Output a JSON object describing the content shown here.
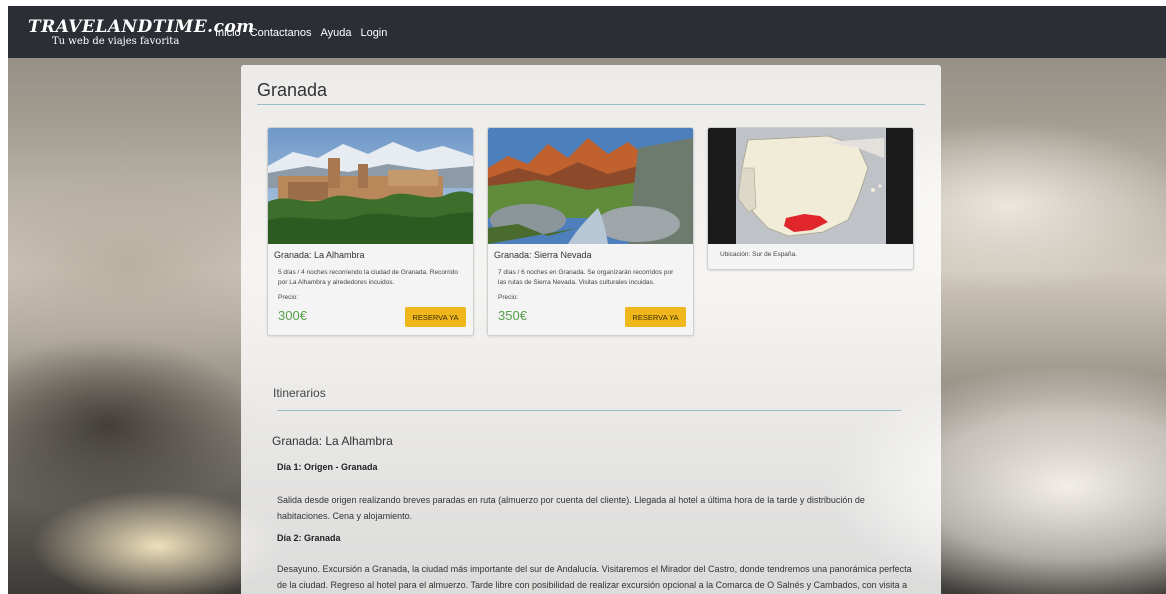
{
  "brand": {
    "logo": "TRAVELANDTIME.com",
    "tagline": "Tu web de viajes favorita"
  },
  "nav": {
    "items": [
      "Inicio",
      "Contactanos",
      "Ayuda",
      "Login"
    ]
  },
  "page": {
    "title": "Granada",
    "cards": [
      {
        "title": "Granada: La Alhambra",
        "description": "5 días / 4 noches recorriendo la ciudad de Granada. Recorrido por La Alhambra y alrededores incuidos.",
        "price_label": "Precio:",
        "price": "300€",
        "button": "RESERVA YA"
      },
      {
        "title": "Granada: Sierra Nevada",
        "description": "7 días / 6 noches en Granada. Se organizarán recorridos por las rutas de Sierra Nevada. Visitas culturales incuidas.",
        "price_label": "Precio:",
        "price": "350€",
        "button": "RESERVA YA"
      }
    ],
    "map_caption": "Ubicación: Sur de España.",
    "itinerary": {
      "heading": "Itinerarios",
      "subtitle": "Granada: La Alhambra",
      "days": [
        {
          "title": "Día 1: Origen - Granada",
          "text": "Salida desde origen realizando breves paradas en ruta (almuerzo por cuenta del cliente). Llegada al hotel a última hora de la tarde y distribución de habitaciones. Cena y alojamiento."
        },
        {
          "title": "Día 2: Granada",
          "text": "Desayuno. Excursión a Granada, la ciudad más importante del sur de Andalucía. Visitaremos el Mirador del Castro, donde tendremos una panorámica perfecta de la ciudad. Regreso al hotel para el almuerzo. Tarde libre con posibilidad de realizar excursión opcional a la Comarca de O Salnés y Cambados, con visita a bodega denominación Rías Baixas con degustación de vino albariño. Cena y alojamiento."
        }
      ]
    }
  },
  "colors": {
    "nav_bg": "#2b2f35",
    "price": "#5aa04a",
    "button": "#efb71c",
    "rule": "#9bbcc4"
  }
}
